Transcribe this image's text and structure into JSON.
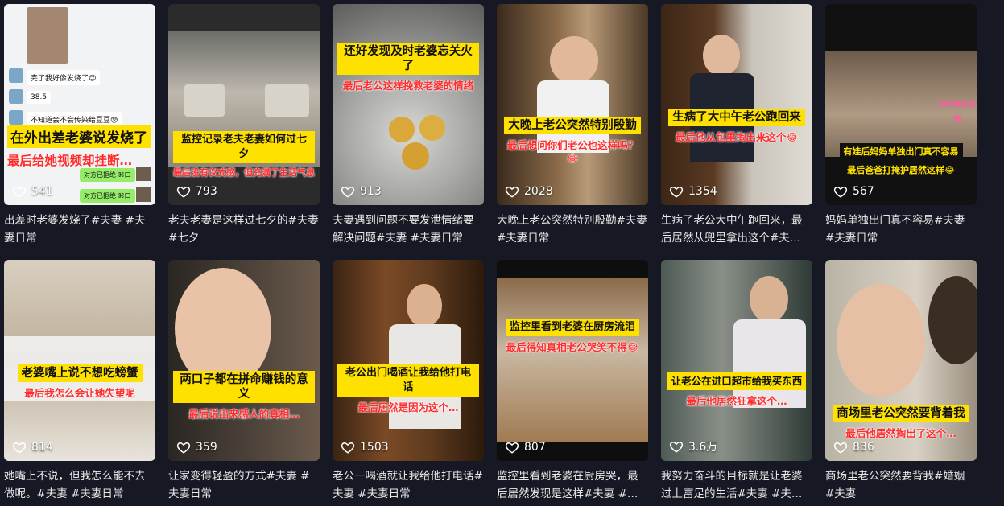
{
  "videos": [
    {
      "likes": "541",
      "caption": "出差时老婆发烧了#夫妻 #夫妻日常",
      "overlay_yellow": "在外出差老婆说发烧了",
      "overlay_red": "最后给她视频却挂断…",
      "chat": {
        "msg1": "完了我好像发烧了😊",
        "msg2": "38.5",
        "msg3": "不知道会不会传染给豆豆😰",
        "reply1": "对方已拒绝 ⌘口",
        "reply2": "对方已拒绝 ⌘口"
      }
    },
    {
      "likes": "793",
      "caption": "老夫老妻是这样过七夕的#夫妻 #七夕",
      "overlay_yellow": "监控记录老夫老妻如何过七夕",
      "overlay_red": "最后没有仪式感，但充满了生活气息"
    },
    {
      "likes": "913",
      "caption": "夫妻遇到问题不要发泄情绪要解决问题#夫妻 #夫妻日常",
      "overlay_yellow": "还好发现及时老婆忘关火了",
      "overlay_red": "最后老公这样挽救老婆的情绪"
    },
    {
      "likes": "2028",
      "caption": "大晚上老公突然特别殷勤#夫妻 #夫妻日常",
      "overlay_yellow": "大晚上老公突然特别殷勤",
      "overlay_red": "最后想问你们老公也这样吗？😂"
    },
    {
      "likes": "1354",
      "caption": "生病了老公大中午跑回来，最后居然从兜里拿出这个#夫…",
      "overlay_yellow": "生病了大中午老公跑回来",
      "overlay_red": "最后他从包里掏出来这个😂"
    },
    {
      "likes": "567",
      "caption": "妈妈单独出门真不容易#夫妻 #夫妻日常",
      "overlay_yellow": "有娃后妈妈单独出门真不容易",
      "overlay_red": "最后爸爸打掩护居然这样😂",
      "overlay_tag": "妈妈躲在后面"
    },
    {
      "likes": "814",
      "caption": "她嘴上不说，但我怎么能不去做呢。#夫妻 #夫妻日常",
      "overlay_yellow": "老婆嘴上说不想吃螃蟹",
      "overlay_red": "最后我怎么会让她失望呢"
    },
    {
      "likes": "359",
      "caption": "让家变得轻盈的方式#夫妻 #夫妻日常",
      "overlay_yellow": "两口子都在拼命赚钱的意义",
      "overlay_red": "最后说出来感人的真相…"
    },
    {
      "likes": "1503",
      "caption": "老公一喝酒就让我给他打电话#夫妻 #夫妻日常",
      "overlay_yellow": "老公出门喝酒让我给他打电话",
      "overlay_red": "最后居然是因为这个…"
    },
    {
      "likes": "807",
      "caption": "监控里看到老婆在厨房哭，最后居然发现是这样#夫妻 #…",
      "overlay_yellow": "监控里看到老婆在厨房流泪",
      "overlay_red": "最后得知真相老公哭笑不得😂"
    },
    {
      "likes": "3.6万",
      "caption": "我努力奋斗的目标就是让老婆过上富足的生活#夫妻 #夫…",
      "overlay_yellow": "让老公在进口超市给我买东西",
      "overlay_red": "最后他居然狂拿这个…"
    },
    {
      "likes": "836",
      "caption": "商场里老公突然要背我#婚姻 #夫妻",
      "overlay_yellow": "商场里老公突然要背着我",
      "overlay_red": "最后他居然掏出了这个…"
    }
  ],
  "icons": {
    "like": "heart-outline-icon"
  },
  "colors": {
    "background": "#161823",
    "highlight": "#ffe100",
    "accent": "#ff2d2d"
  }
}
